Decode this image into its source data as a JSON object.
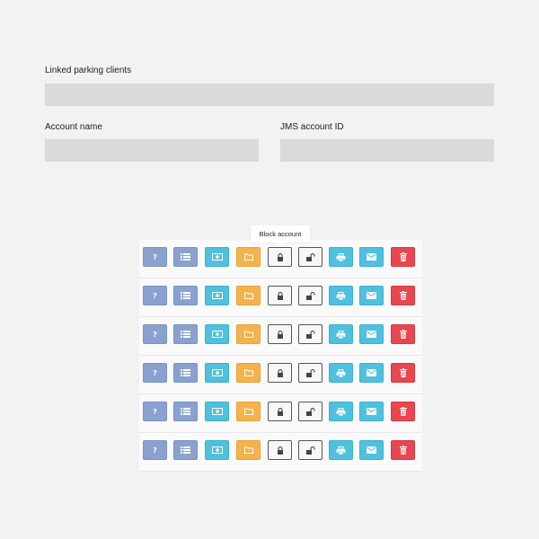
{
  "form": {
    "linked_parking_clients_label": "Linked parking clients",
    "linked_parking_clients_value": "",
    "account_name_label": "Account name",
    "account_name_value": "",
    "jms_account_id_label": "JMS account ID",
    "jms_account_id_value": ""
  },
  "tooltip": {
    "text": "Block account"
  },
  "account_rows": [
    {
      "actions": [
        "help",
        "list",
        "money",
        "folder",
        "lock",
        "unlock",
        "print",
        "mail",
        "trash"
      ]
    },
    {
      "actions": [
        "help",
        "list",
        "money",
        "folder",
        "lock",
        "unlock",
        "print",
        "mail",
        "trash"
      ]
    },
    {
      "actions": [
        "help",
        "list",
        "money",
        "folder",
        "lock",
        "unlock",
        "print",
        "mail",
        "trash"
      ]
    },
    {
      "actions": [
        "help",
        "list",
        "money",
        "folder",
        "lock",
        "unlock",
        "print",
        "mail",
        "trash"
      ]
    },
    {
      "actions": [
        "help",
        "list",
        "money",
        "folder",
        "lock",
        "unlock",
        "print",
        "mail",
        "trash"
      ]
    },
    {
      "actions": [
        "help",
        "list",
        "money",
        "folder",
        "lock",
        "unlock",
        "print",
        "mail",
        "trash"
      ]
    }
  ],
  "icons": {
    "help": "question-icon",
    "list": "list-icon",
    "money": "money-icon",
    "folder": "folder-icon",
    "lock": "lock-icon",
    "unlock": "unlock-icon",
    "print": "print-icon",
    "mail": "mail-icon",
    "trash": "trash-icon"
  },
  "colors": {
    "help": "#8aa1d0",
    "list": "#8aa1d0",
    "money": "#4fc0de",
    "folder": "#f4b24a",
    "lock": "#f7f7f7",
    "unlock": "#f7f7f7",
    "print": "#4fc0de",
    "mail": "#4fc0de",
    "trash": "#e8474f"
  }
}
